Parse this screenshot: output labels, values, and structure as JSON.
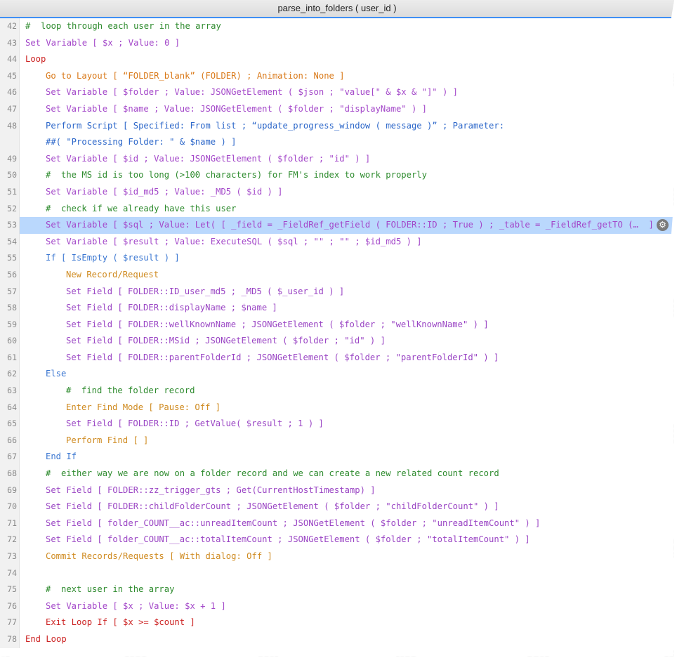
{
  "window": {
    "title": "parse_into_folders ( user_id )"
  },
  "script_lines": [
    {
      "num": "42",
      "indent": 0,
      "cls": "cm",
      "text": "#  loop through each user in the array"
    },
    {
      "num": "43",
      "indent": 0,
      "cls": "sv",
      "text": "Set Variable [ $x ; Value: 0 ]"
    },
    {
      "num": "44",
      "indent": 0,
      "cls": "ct",
      "text": "Loop"
    },
    {
      "num": "45",
      "indent": 1,
      "cls": "nv",
      "text": "Go to Layout [ “FOLDER_blank” (FOLDER) ; Animation: None ]"
    },
    {
      "num": "46",
      "indent": 1,
      "cls": "sv",
      "text": "Set Variable [ $folder ; Value: JSONGetElement ( $json ; \"value[\" & $x & \"]\" ) ]"
    },
    {
      "num": "47",
      "indent": 1,
      "cls": "sv",
      "text": "Set Variable [ $name ; Value: JSONGetElement ( $folder ; \"displayName\" ) ]"
    },
    {
      "num": "48",
      "indent": 1,
      "cls": "pf",
      "text": "Perform Script [ Specified: From list ; “update_progress_window ( message )” ; Parameter:"
    },
    {
      "num": "",
      "indent": 1,
      "cls": "pf",
      "text": "##( \"Processing Folder: \" & $name ) ]"
    },
    {
      "num": "49",
      "indent": 1,
      "cls": "sv",
      "text": "Set Variable [ $id ; Value: JSONGetElement ( $folder ; \"id\" ) ]"
    },
    {
      "num": "50",
      "indent": 1,
      "cls": "cm",
      "text": "#  the MS id is too long (>100 characters) for FM's index to work properly"
    },
    {
      "num": "51",
      "indent": 1,
      "cls": "sv",
      "text": "Set Variable [ $id_md5 ; Value: _MD5 ( $id ) ]"
    },
    {
      "num": "52",
      "indent": 1,
      "cls": "cm",
      "text": "#  check if we already have this user"
    },
    {
      "num": "53",
      "indent": 1,
      "cls": "sv",
      "text": "Set Variable [ $sql ; Value: Let( [ _field = _FieldRef_getField ( FOLDER::ID ; True ) ; _table = _FieldRef_getTO (…  ]",
      "selected": true
    },
    {
      "num": "54",
      "indent": 1,
      "cls": "sv",
      "text": "Set Variable [ $result ; Value: ExecuteSQL ( $sql ; \"\" ; \"\" ; $id_md5 ) ]"
    },
    {
      "num": "55",
      "indent": 1,
      "cls": "el",
      "text": "If [ IsEmpty ( $result ) ]"
    },
    {
      "num": "56",
      "indent": 2,
      "cls": "rc",
      "text": "New Record/Request"
    },
    {
      "num": "57",
      "indent": 2,
      "cls": "fd",
      "text": "Set Field [ FOLDER::ID_user_md5 ; _MD5 ( $_user_id ) ]"
    },
    {
      "num": "58",
      "indent": 2,
      "cls": "fd",
      "text": "Set Field [ FOLDER::displayName ; $name ]"
    },
    {
      "num": "59",
      "indent": 2,
      "cls": "fd",
      "text": "Set Field [ FOLDER::wellKnownName ; JSONGetElement ( $folder ; \"wellKnownName\" ) ]"
    },
    {
      "num": "60",
      "indent": 2,
      "cls": "fd",
      "text": "Set Field [ FOLDER::MSid ; JSONGetElement ( $folder ; \"id\" ) ]"
    },
    {
      "num": "61",
      "indent": 2,
      "cls": "fd",
      "text": "Set Field [ FOLDER::parentFolderId ; JSONGetElement ( $folder ; \"parentFolderId\" ) ]"
    },
    {
      "num": "62",
      "indent": 1,
      "cls": "el",
      "text": "Else"
    },
    {
      "num": "63",
      "indent": 2,
      "cls": "cm",
      "text": "#  find the folder record"
    },
    {
      "num": "64",
      "indent": 2,
      "cls": "rc",
      "text": "Enter Find Mode [ Pause: Off ]"
    },
    {
      "num": "65",
      "indent": 2,
      "cls": "fd",
      "text": "Set Field [ FOLDER::ID ; GetValue( $result ; 1 ) ]"
    },
    {
      "num": "66",
      "indent": 2,
      "cls": "rc",
      "text": "Perform Find [ ]"
    },
    {
      "num": "67",
      "indent": 1,
      "cls": "el",
      "text": "End If"
    },
    {
      "num": "68",
      "indent": 1,
      "cls": "cm",
      "text": "#  either way we are now on a folder record and we can create a new related count record"
    },
    {
      "num": "69",
      "indent": 1,
      "cls": "fd",
      "text": "Set Field [ FOLDER::zz_trigger_gts ; Get(CurrentHostTimestamp) ]"
    },
    {
      "num": "70",
      "indent": 1,
      "cls": "fd",
      "text": "Set Field [ FOLDER::childFolderCount ; JSONGetElement ( $folder ; \"childFolderCount\" ) ]"
    },
    {
      "num": "71",
      "indent": 1,
      "cls": "fd",
      "text": "Set Field [ folder_COUNT__ac::unreadItemCount ; JSONGetElement ( $folder ; \"unreadItemCount\" ) ]"
    },
    {
      "num": "72",
      "indent": 1,
      "cls": "fd",
      "text": "Set Field [ folder_COUNT__ac::totalItemCount ; JSONGetElement ( $folder ; \"totalItemCount\" ) ]"
    },
    {
      "num": "73",
      "indent": 1,
      "cls": "rc",
      "text": "Commit Records/Requests [ With dialog: Off ]"
    },
    {
      "num": "74",
      "indent": 1,
      "cls": "cm",
      "text": ""
    },
    {
      "num": "75",
      "indent": 1,
      "cls": "cm",
      "text": "#  next user in the array"
    },
    {
      "num": "76",
      "indent": 1,
      "cls": "sv",
      "text": "Set Variable [ $x ; Value: $x + 1 ]"
    },
    {
      "num": "77",
      "indent": 1,
      "cls": "ct",
      "text": "Exit Loop If [ $x >= $count ]"
    },
    {
      "num": "78",
      "indent": 0,
      "cls": "ct",
      "text": "End Loop"
    }
  ],
  "icons": {
    "gear": "gear-icon"
  },
  "colors": {
    "selection": "#bad8fd",
    "comment": "#2e8b2e",
    "set_variable": "#a347c9",
    "control": "#cc2222",
    "navigation": "#d97817",
    "if_else": "#3a76d1",
    "accent": "#3f8ff5"
  }
}
